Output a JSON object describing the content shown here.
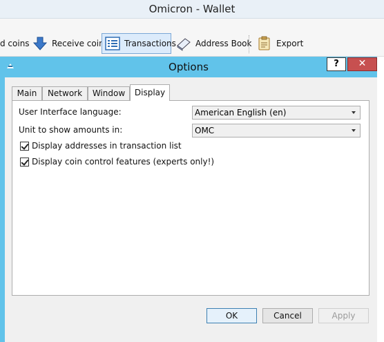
{
  "main_window": {
    "title": "Omicron - Wallet"
  },
  "toolbar": {
    "items": [
      {
        "label": "d coins"
      },
      {
        "label": "Receive coins"
      },
      {
        "label": "Transactions"
      },
      {
        "label": "Address Book"
      },
      {
        "label": "Export"
      }
    ]
  },
  "dialog": {
    "title": "Options",
    "help_label": "?",
    "close_label": "✕",
    "tabs": [
      {
        "label": "Main"
      },
      {
        "label": "Network"
      },
      {
        "label": "Window"
      },
      {
        "label": "Display"
      }
    ],
    "selected_tab": "Display",
    "display": {
      "language_label": "User Interface language:",
      "language_value": "American English (en)",
      "unit_label": "Unit to show amounts in:",
      "unit_value": "OMC",
      "show_addresses_label": "Display addresses in transaction list",
      "show_addresses_checked": true,
      "coin_control_label": "Display coin control features (experts only!)",
      "coin_control_checked": true
    },
    "buttons": {
      "ok": "OK",
      "cancel": "Cancel",
      "apply": "Apply"
    }
  },
  "colors": {
    "dialog_frame": "#61c3ea",
    "close_button": "#c75050",
    "toolbar_active": "#dcebfb"
  }
}
